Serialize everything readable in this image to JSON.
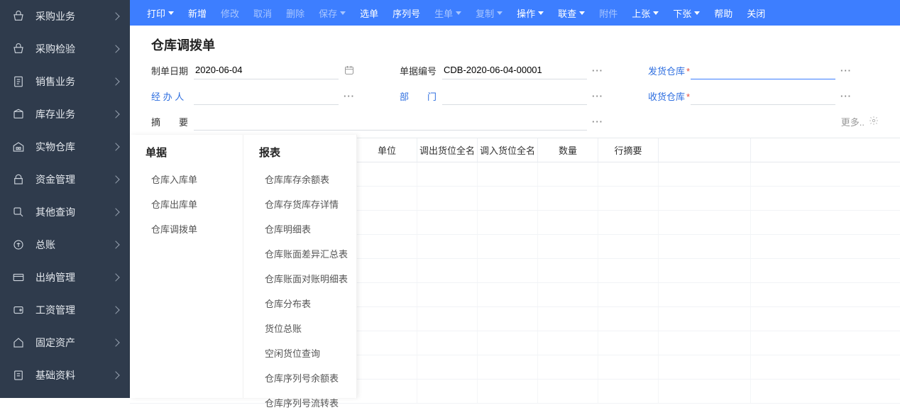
{
  "sidebar": {
    "items": [
      {
        "label": "采购业务",
        "icon": "basket"
      },
      {
        "label": "采购检验",
        "icon": "basket"
      },
      {
        "label": "销售业务",
        "icon": "doc"
      },
      {
        "label": "库存业务",
        "icon": "box"
      },
      {
        "label": "实物仓库",
        "icon": "warehouse"
      },
      {
        "label": "资金管理",
        "icon": "bag"
      },
      {
        "label": "其他查询",
        "icon": "search"
      },
      {
        "label": "总账",
        "icon": "coin"
      },
      {
        "label": "出纳管理",
        "icon": "card"
      },
      {
        "label": "工资管理",
        "icon": "wallet"
      },
      {
        "label": "固定资产",
        "icon": "home"
      },
      {
        "label": "基础资料",
        "icon": "file"
      }
    ]
  },
  "toolbar": [
    {
      "label": "打印",
      "caret": true,
      "disabled": false
    },
    {
      "label": "新增",
      "caret": false,
      "disabled": false
    },
    {
      "label": "修改",
      "caret": false,
      "disabled": true
    },
    {
      "label": "取消",
      "caret": false,
      "disabled": true
    },
    {
      "label": "删除",
      "caret": false,
      "disabled": true
    },
    {
      "label": "保存",
      "caret": true,
      "disabled": true
    },
    {
      "label": "选单",
      "caret": false,
      "disabled": false
    },
    {
      "label": "序列号",
      "caret": false,
      "disabled": false
    },
    {
      "label": "生单",
      "caret": true,
      "disabled": true
    },
    {
      "label": "复制",
      "caret": true,
      "disabled": true
    },
    {
      "label": "操作",
      "caret": true,
      "disabled": false
    },
    {
      "label": "联查",
      "caret": true,
      "disabled": false
    },
    {
      "label": "附件",
      "caret": false,
      "disabled": true
    },
    {
      "label": "上张",
      "caret": true,
      "disabled": false
    },
    {
      "label": "下张",
      "caret": true,
      "disabled": false
    },
    {
      "label": "帮助",
      "caret": false,
      "disabled": false
    },
    {
      "label": "关闭",
      "caret": false,
      "disabled": false
    }
  ],
  "page_title": "仓库调拨单",
  "form": {
    "row1": {
      "date_label": "制单日期",
      "date_value": "2020-06-04",
      "docno_label": "单据编号",
      "docno_value": "CDB-2020-06-04-00001",
      "out_wh_label": "发货仓库",
      "out_wh_value": ""
    },
    "row2": {
      "operator_label": "经 办 人",
      "operator_value": "",
      "dept_label": "部　　门",
      "dept_value": "",
      "in_wh_label": "收货仓库",
      "in_wh_value": ""
    },
    "row3": {
      "remark_label": "摘　　要",
      "remark_value": "",
      "more_label": "更多.."
    }
  },
  "grid": {
    "cols": [
      "单位",
      "调出货位全名",
      "调入货位全名",
      "数量",
      "行摘要",
      ""
    ]
  },
  "submenu": {
    "left_head": "单据",
    "left_items": [
      "仓库入库单",
      "仓库出库单",
      "仓库调拨单"
    ],
    "right_head": "报表",
    "right_items": [
      "仓库库存余额表",
      "仓库存货库存详情",
      "仓库明细表",
      "仓库账面差异汇总表",
      "仓库账面对账明细表",
      "仓库分布表",
      "货位总账",
      "空闲货位查询",
      "仓库序列号余额表",
      "仓库序列号流转表"
    ]
  }
}
